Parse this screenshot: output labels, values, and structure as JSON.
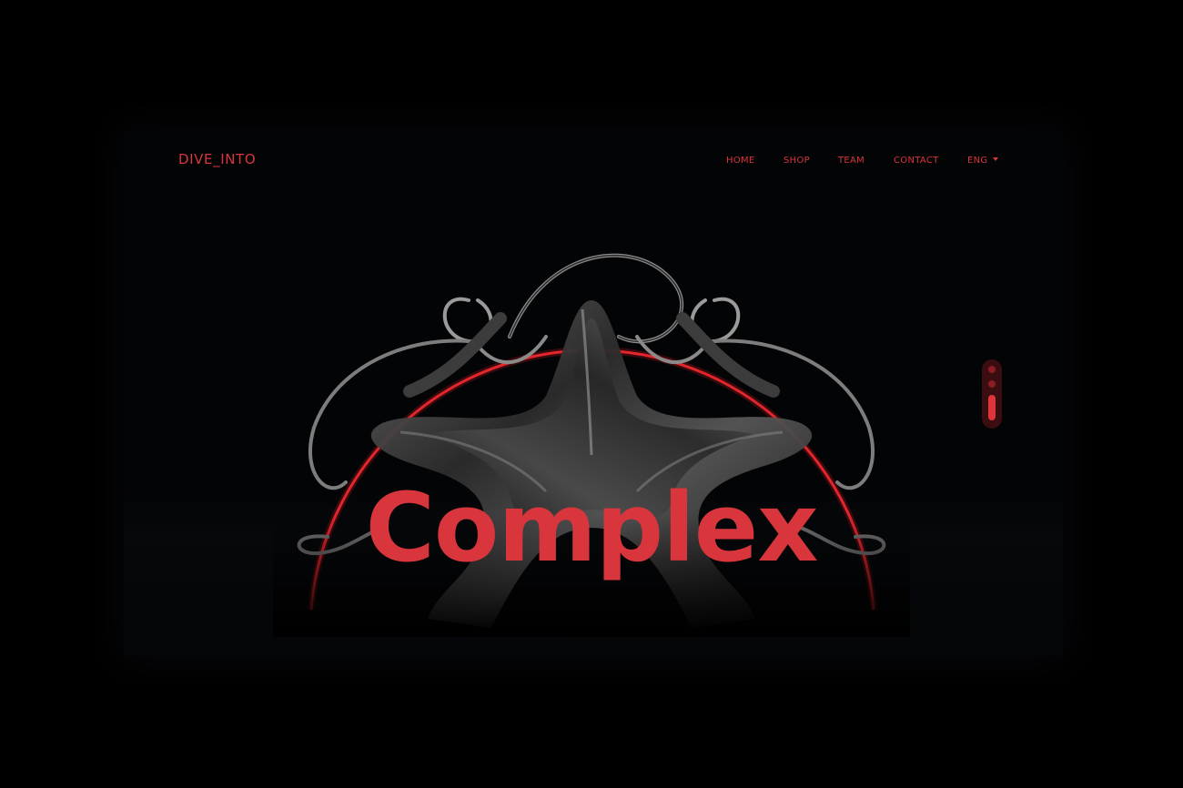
{
  "header": {
    "logo": "DIVE_INTO",
    "nav": [
      {
        "label": "HOME"
      },
      {
        "label": "SHOP"
      },
      {
        "label": "TEAM"
      },
      {
        "label": "CONTACT"
      }
    ],
    "language": {
      "label": "ENG",
      "icon": "chevron-down-icon"
    }
  },
  "hero": {
    "headline": "Complex",
    "artwork": "twisted-metal-sculpture-with-red-ring"
  },
  "slider": {
    "slides": 3,
    "active_slide": 3
  },
  "colors": {
    "accent": "#d8353c",
    "background": "#000000",
    "frame": "#030406",
    "slider_track": "#3a0d10",
    "slider_dot": "#8e1c22"
  }
}
